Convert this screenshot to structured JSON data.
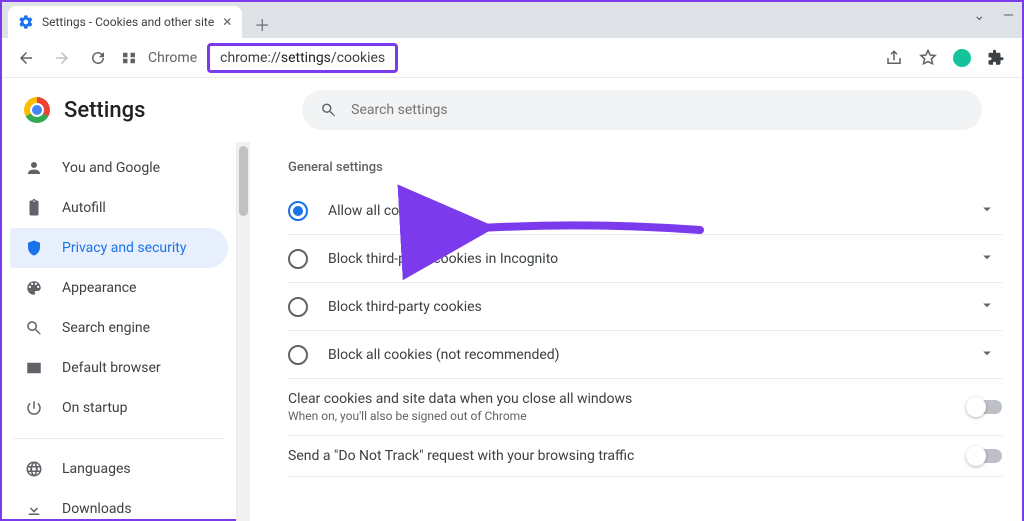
{
  "tab": {
    "title": "Settings - Cookies and other site"
  },
  "address": {
    "chrome_label": "Chrome",
    "url_prefix": "chrome://",
    "url_bold": "settings",
    "url_suffix": "/cookies"
  },
  "header": {
    "title": "Settings",
    "search_placeholder": "Search settings"
  },
  "sidebar": {
    "items": [
      {
        "label": "You and Google"
      },
      {
        "label": "Autofill"
      },
      {
        "label": "Privacy and security"
      },
      {
        "label": "Appearance"
      },
      {
        "label": "Search engine"
      },
      {
        "label": "Default browser"
      },
      {
        "label": "On startup"
      }
    ],
    "lower": [
      {
        "label": "Languages"
      },
      {
        "label": "Downloads"
      }
    ]
  },
  "main": {
    "section_title": "General settings",
    "cookies": [
      {
        "label": "Allow all cookies",
        "selected": true
      },
      {
        "label": "Block third-party cookies in Incognito",
        "selected": false
      },
      {
        "label": "Block third-party cookies",
        "selected": false
      },
      {
        "label": "Block all cookies (not recommended)",
        "selected": false
      }
    ],
    "toggles": [
      {
        "primary": "Clear cookies and site data when you close all windows",
        "secondary": "When on, you'll also be signed out of Chrome"
      },
      {
        "primary": "Send a \"Do Not Track\" request with your browsing traffic",
        "secondary": ""
      }
    ]
  },
  "colors": {
    "accent": "#1a73e8",
    "highlight_border": "#7c3aed"
  }
}
